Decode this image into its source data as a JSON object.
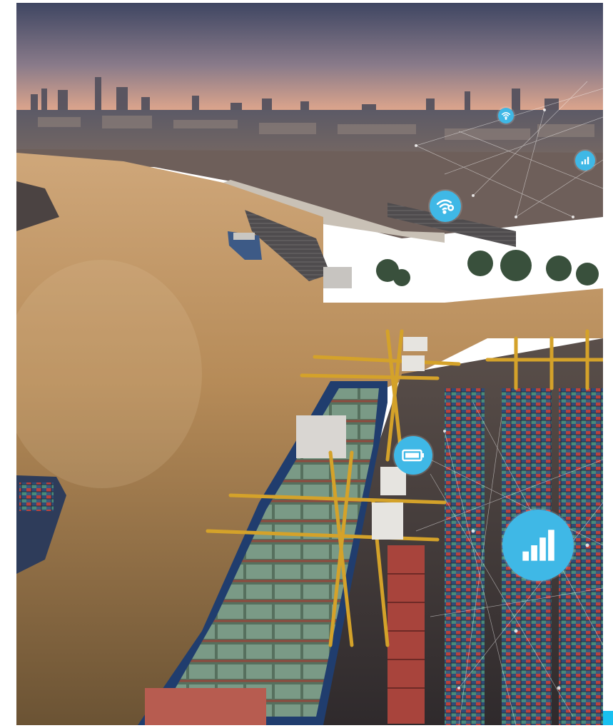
{
  "image": {
    "scene": "aerial-harbor-city",
    "icons": [
      "wifi-icon",
      "wifi-icon",
      "signal-bars-icon",
      "battery-icon",
      "signal-bars-icon"
    ]
  },
  "colors": {
    "badge": "#3fb8e6",
    "accent": "#19c0f0",
    "river": "#b08a55",
    "sky_top": "#4a4f6a",
    "sky_glow": "#e7a98a"
  }
}
